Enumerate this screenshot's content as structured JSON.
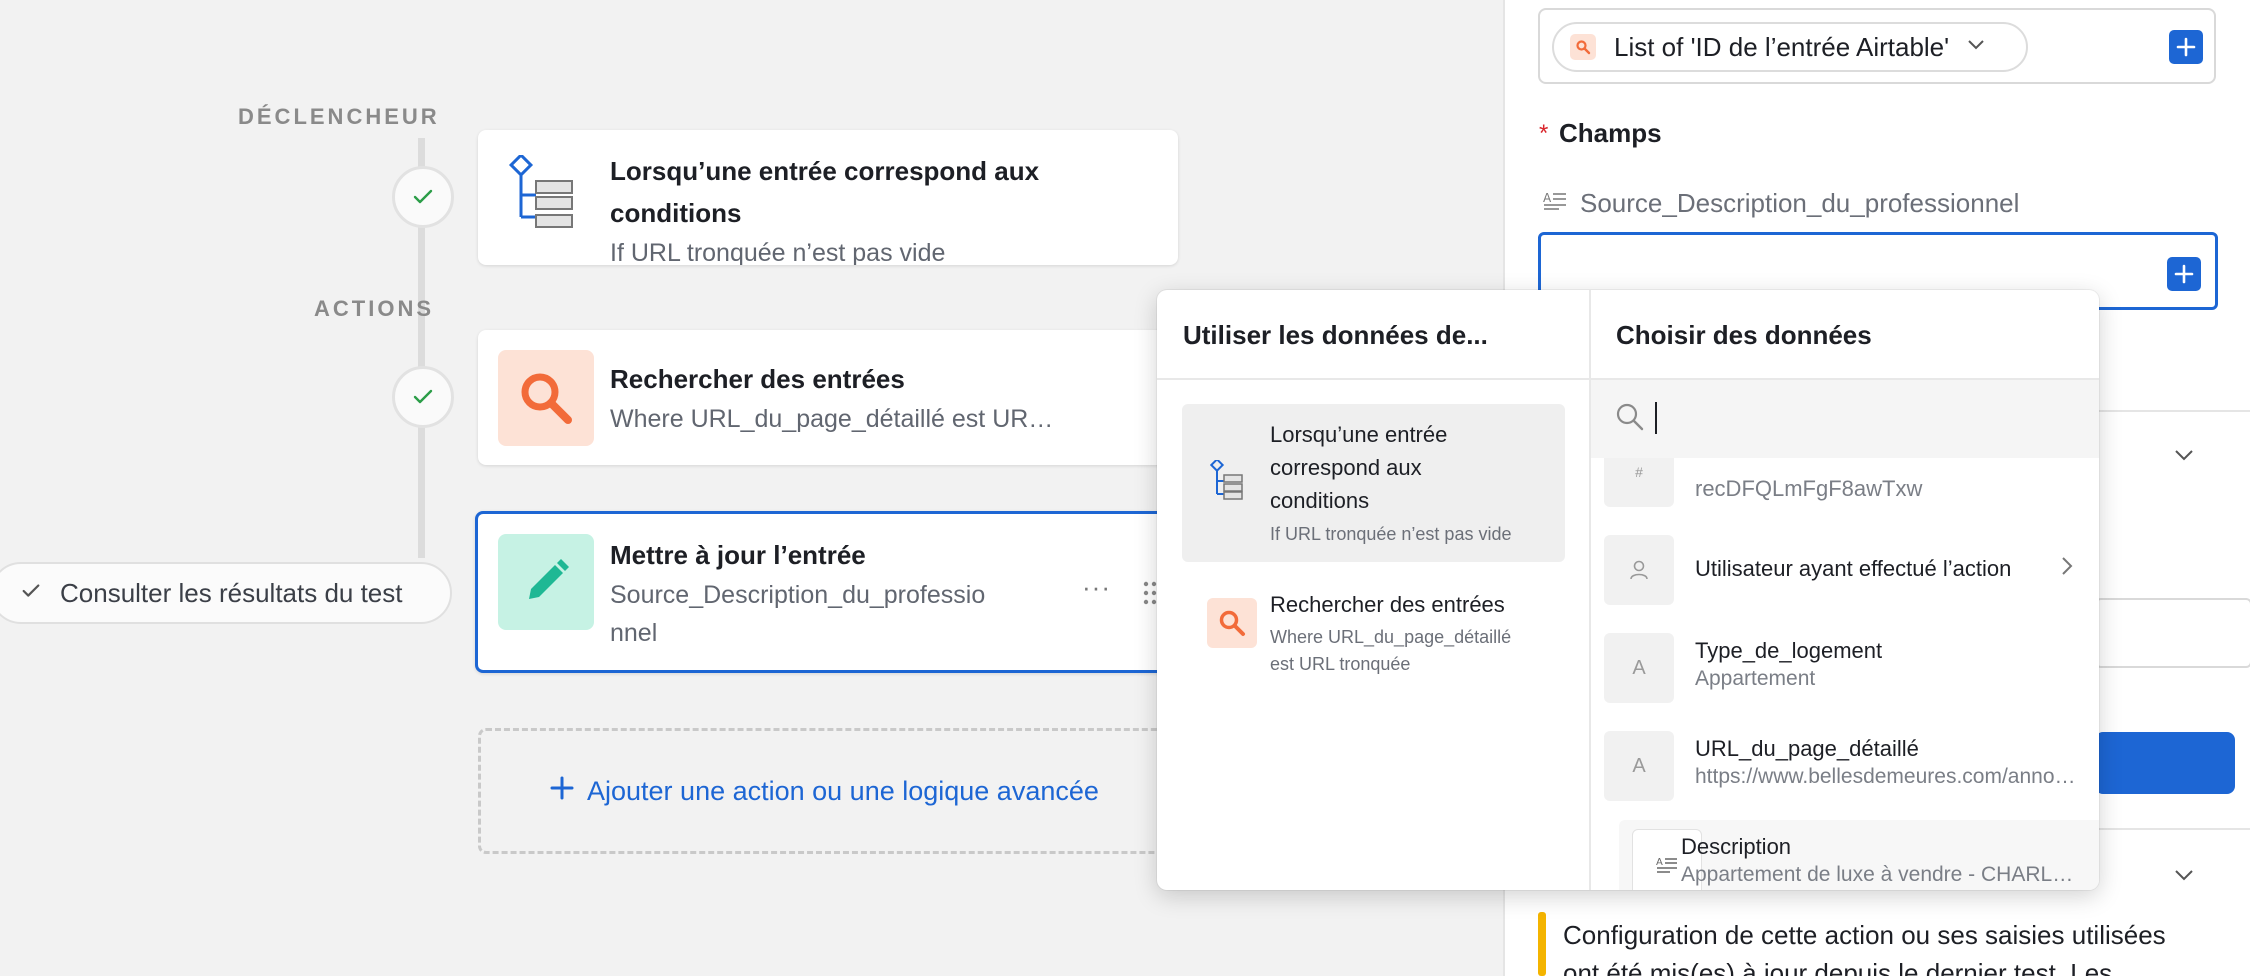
{
  "flow": {
    "trigger_label": "DÉCLENCHEUR",
    "actions_label": "ACTIONS",
    "trigger_card": {
      "title": "Lorsqu’une entrée correspond aux conditions",
      "title_line1": "Lorsqu’une entrée correspond aux",
      "title_line2": "conditions",
      "subtitle": "If URL tronquée n’est pas vide"
    },
    "search_card": {
      "title": "Rechercher des entrées",
      "subtitle": "Where URL_du_page_détaillé est UR…"
    },
    "update_card": {
      "title": "Mettre à jour l’entrée",
      "subtitle_line1": "Source_Description_du_professio",
      "subtitle_line2": "nnel",
      "more_label": "···"
    },
    "test_results_label": "Consulter les résultats du test",
    "add_action_label": "Ajouter une action ou une logique avancée"
  },
  "right_panel": {
    "list_token_label": "List of 'ID de l’entrée Airtable'",
    "required_marker": "*",
    "fields_label": "Champs",
    "field_name": "Source_Description_du_professionnel",
    "warning_line1": "Configuration de cette action ou ses saisies utilisées",
    "warning_line2": "ont été mis(es) à jour depuis le dernier test. Les"
  },
  "popover": {
    "left_header": "Utiliser les données de...",
    "right_header": "Choisir des données",
    "search_placeholder": "",
    "sources": [
      {
        "title_line1": "Lorsqu’une entrée",
        "title_line2": "correspond aux",
        "title_line3": "conditions",
        "subtitle": "If URL tronquée n’est pas vide"
      },
      {
        "title": "Rechercher des entrées",
        "subtitle_line1": "Where URL_du_page_détaillé",
        "subtitle_line2": "est URL tronquée"
      }
    ],
    "data_items": [
      {
        "title": "recDFQLmFgF8awTxw",
        "icon": "id-icon"
      },
      {
        "title": "Utilisateur ayant effectué l’action",
        "icon": "user-icon"
      },
      {
        "title": "Type_de_logement",
        "subtitle": "Appartement",
        "icon": "text-a-icon"
      },
      {
        "title": "URL_du_page_détaillé",
        "subtitle": "https://www.bellesdemeures.com/anno…",
        "icon": "text-a-icon"
      },
      {
        "title": "Description",
        "subtitle": "Appartement de luxe à vendre - CHARL…",
        "icon": "long-text-icon"
      }
    ]
  },
  "colors": {
    "accent": "#1d66d4",
    "search_orange": "#f26b3a",
    "update_teal": "#1fb894",
    "warning_yellow": "#f4b400"
  }
}
